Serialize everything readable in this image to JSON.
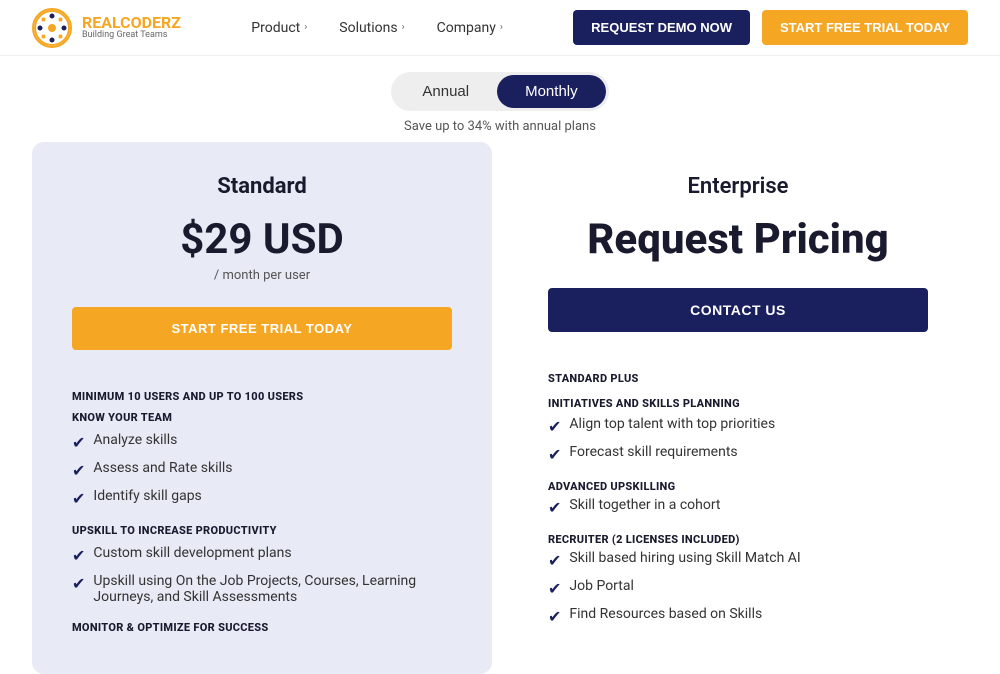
{
  "header": {
    "logo": {
      "brand_start": "REAL",
      "brand_end": "CODERZ",
      "tagline": "Building Great Teams"
    },
    "nav": [
      {
        "label": "Product",
        "has_chevron": true
      },
      {
        "label": "Solutions",
        "has_chevron": true
      },
      {
        "label": "Company",
        "has_chevron": true
      }
    ],
    "buttons": {
      "demo": "REQUEST DEMO NOW",
      "trial": "START FREE TRIAL TODAY"
    }
  },
  "billing_toggle": {
    "annual_label": "Annual",
    "monthly_label": "Monthly",
    "active": "monthly",
    "savings_text": "Save up to 34% with annual plans"
  },
  "plans": {
    "standard": {
      "title": "Standard",
      "price": "$29 USD",
      "period": "/ month per user",
      "cta": "START FREE TRIAL TODAY",
      "sections": [
        {
          "header": "MINIMUM 10 USERS AND UP TO 100 USERS",
          "sub_header": "KNOW YOUR TEAM",
          "features": [
            "Analyze skills",
            "Assess and Rate skills",
            "Identify skill gaps"
          ]
        },
        {
          "header": "UPSKILL TO INCREASE PRODUCTIVITY",
          "features": [
            "Custom skill development plans",
            "Upskill using On the Job Projects, Courses, Learning Journeys, and Skill Assessments"
          ]
        },
        {
          "header": "MONITOR & OPTIMIZE FOR SUCCESS",
          "features": []
        }
      ]
    },
    "enterprise": {
      "title": "Enterprise",
      "price": "Request Pricing",
      "cta": "CONTACT US",
      "sections": [
        {
          "header": "STANDARD PLUS",
          "sub_header": "INITIATIVES AND SKILLS PLANNING",
          "features": [
            "Align top talent with top priorities",
            "Forecast skill requirements"
          ]
        },
        {
          "header": "ADVANCED UPSKILLING",
          "features": [
            "Skill together in a cohort"
          ]
        },
        {
          "header": "RECRUITER (2 LICENSES INCLUDED)",
          "features": [
            "Skill based hiring using Skill Match AI",
            "Job Portal",
            "Find Resources based on Skills"
          ]
        }
      ]
    }
  }
}
